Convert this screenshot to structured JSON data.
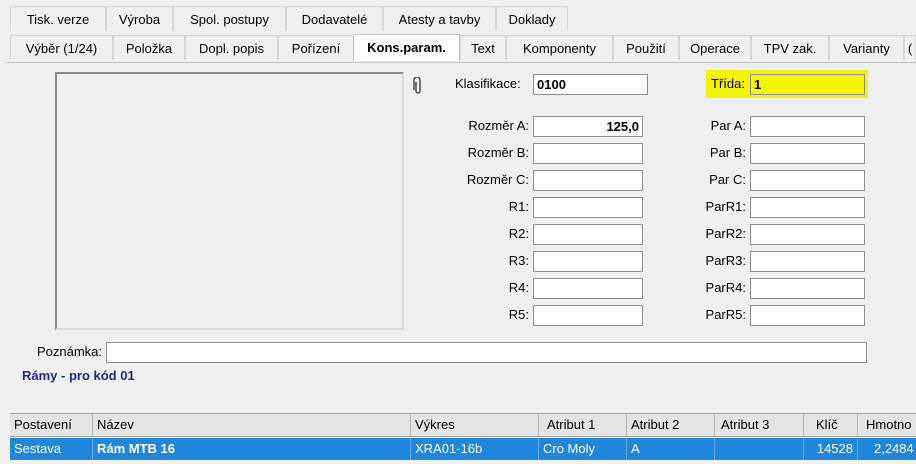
{
  "tabs_row1": [
    "Tisk. verze",
    "Výroba",
    "Spol. postupy",
    "Dodavatelé",
    "Atesty a tavby",
    "Doklady"
  ],
  "tabs_row2": [
    "Výběr (1/24)",
    "Položka",
    "Dopl. popis",
    "Pořízení",
    "Kons.param.",
    "Text",
    "Komponenty",
    "Použití",
    "Operace",
    "TPV zak.",
    "Varianty",
    "("
  ],
  "active_tab": "Kons.param.",
  "form": {
    "klasifikace_label": "Klasifikace:",
    "klasifikace_value": "0100",
    "trida_label": "Třída:",
    "trida_value": "1",
    "left_fields": [
      {
        "label": "Rozměr A:",
        "value": "125,0"
      },
      {
        "label": "Rozměr B:",
        "value": ""
      },
      {
        "label": "Rozměr C:",
        "value": ""
      },
      {
        "label": "R1:",
        "value": ""
      },
      {
        "label": "R2:",
        "value": ""
      },
      {
        "label": "R3:",
        "value": ""
      },
      {
        "label": "R4:",
        "value": ""
      },
      {
        "label": "R5:",
        "value": ""
      }
    ],
    "right_fields": [
      {
        "label": "Par A:",
        "value": ""
      },
      {
        "label": "Par B:",
        "value": ""
      },
      {
        "label": "Par C:",
        "value": ""
      },
      {
        "label": "ParR1:",
        "value": ""
      },
      {
        "label": "ParR2:",
        "value": ""
      },
      {
        "label": "ParR3:",
        "value": ""
      },
      {
        "label": "ParR4:",
        "value": ""
      },
      {
        "label": "ParR5:",
        "value": ""
      }
    ],
    "poznamka_label": "Poznámka:",
    "poznamka_value": "",
    "note_text": "Rámy - pro kód 01"
  },
  "grid": {
    "headers": [
      "Postavení",
      "Název",
      "Výkres",
      "Atribut 1",
      "Atribut 2",
      "Atribut 3",
      "Klíč",
      "Hmotno"
    ],
    "row": [
      "Sestava",
      "Rám MTB 16",
      "XRA01-16b",
      "Cro Moly",
      "A",
      "",
      "14528",
      "2,2484"
    ]
  },
  "colors": {
    "highlight": "#f4f40a",
    "selection": "#1f86dc",
    "note": "#1a2a8a"
  },
  "icons": {
    "attachment": "paperclip-icon"
  }
}
